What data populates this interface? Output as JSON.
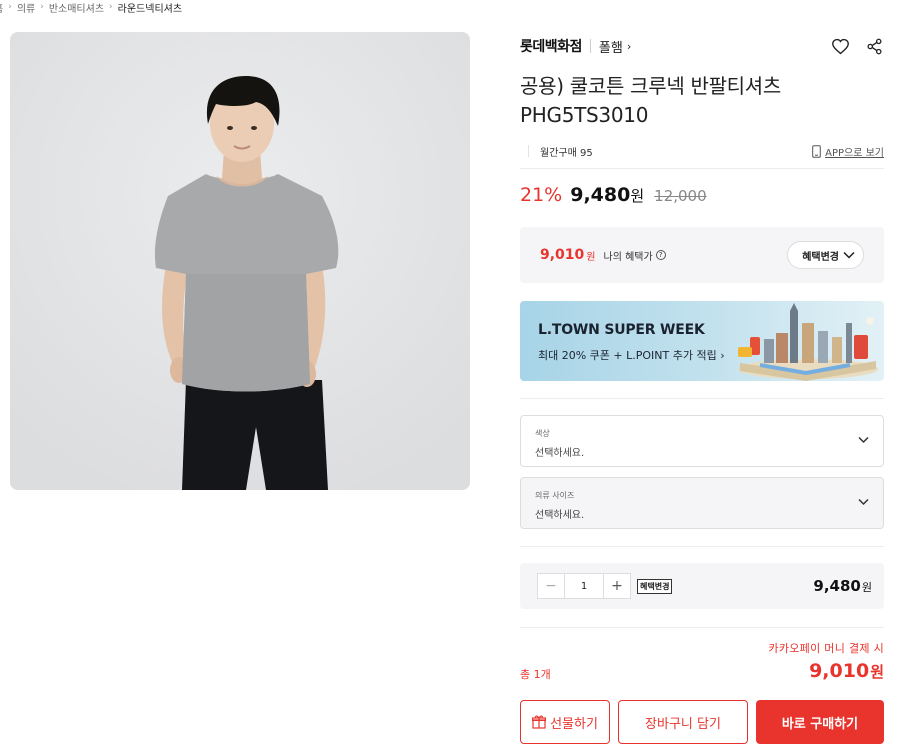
{
  "breadcrumb": [
    {
      "label": "홈"
    },
    {
      "label": "의류"
    },
    {
      "label": "반소매티셔츠"
    },
    {
      "label": "라운드넥티셔츠",
      "current": true
    }
  ],
  "product": {
    "brand": "롯데백화점",
    "shop": "폴햄",
    "title_line1": "공용) 쿨코튼 크루넥 반팔티셔츠",
    "title_line2": "PHG5TS3010",
    "monthly_purchase": "월간구매 95",
    "app_link": "APP으로 보기",
    "image_icon": "product-photo-tshirt-model"
  },
  "price": {
    "discount": "21%",
    "amount": "9,480",
    "unit": "원",
    "original": "12,000"
  },
  "benefit": {
    "price": "9,010",
    "unit": "원",
    "label": "나의 혜택가",
    "help_icon": "?",
    "change_button": "혜택변경"
  },
  "banner": {
    "title": "L.TOWN SUPER WEEK",
    "subtitle": "최대 20% 쿠폰 + L.POINT 추가 적립 ›"
  },
  "options": [
    {
      "label": "색상",
      "placeholder": "선택하세요."
    },
    {
      "label": "의류 사이즈",
      "placeholder": "선택하세요."
    }
  ],
  "quantity": {
    "minus": "−",
    "value": "1",
    "plus": "+",
    "benefit_tag": "혜택변경",
    "price": "9,480",
    "unit": "원"
  },
  "summary": {
    "pay_note": "카카오페이 머니 결제 시",
    "count": "총 1개",
    "total": "9,010",
    "unit": "원"
  },
  "buttons": {
    "gift": "선물하기",
    "cart": "장바구니 담기",
    "buy": "바로 구매하기"
  },
  "colors": {
    "accent": "#e8342d",
    "box_bg": "#f5f5f7",
    "banner_bg": "#b8dcea"
  }
}
